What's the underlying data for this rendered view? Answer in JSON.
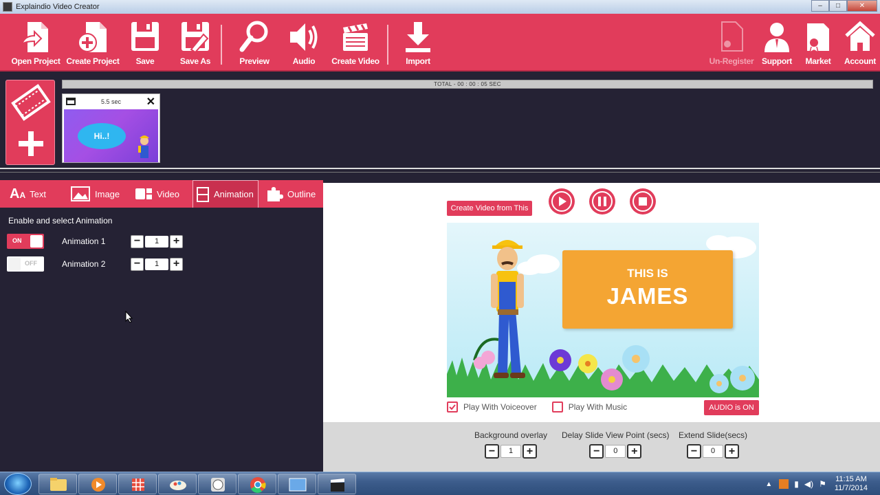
{
  "window": {
    "title": "Explaindio Video Creator"
  },
  "toolbar": {
    "open_project": "Open Project",
    "create_project": "Create Project",
    "save": "Save",
    "save_as": "Save As",
    "preview": "Preview",
    "audio": "Audio",
    "create_video": "Create Video",
    "import": "Import",
    "unregister": "Un-Register",
    "support": "Support",
    "market": "Market",
    "account": "Account"
  },
  "timeline": {
    "total": "TOTAL - 00 : 00 : 05 SEC",
    "slide": {
      "duration": "5.5 sec",
      "bubble_text": "Hi..!"
    }
  },
  "tabs": {
    "text": "Text",
    "image": "Image",
    "video": "Video",
    "animation": "Animation",
    "outline": "Outline"
  },
  "animation_panel": {
    "heading": "Enable and select Animation",
    "rows": [
      {
        "toggle": "ON",
        "label": "Animation 1",
        "value": "1"
      },
      {
        "toggle": "OFF",
        "label": "Animation 2",
        "value": "1"
      }
    ]
  },
  "preview": {
    "create_slide_button": "Create Video from This Slide",
    "banner_line1": "THIS IS",
    "banner_line2": "JAMES",
    "voiceover_label": "Play With Voiceover",
    "music_label": "Play With Music",
    "audio_button": "AUDIO is ON"
  },
  "options": {
    "background_overlay": {
      "label": "Background overlay",
      "value": "1"
    },
    "delay": {
      "label": "Delay Slide View Point (secs)",
      "value": "0"
    },
    "extend": {
      "label": "Extend Slide(secs)",
      "value": "0"
    }
  },
  "taskbar": {
    "time": "11:15 AM",
    "date": "11/7/2014"
  },
  "colors": {
    "accent": "#e13c5b",
    "panel_bg": "#252234",
    "banner": "#f4a533"
  }
}
